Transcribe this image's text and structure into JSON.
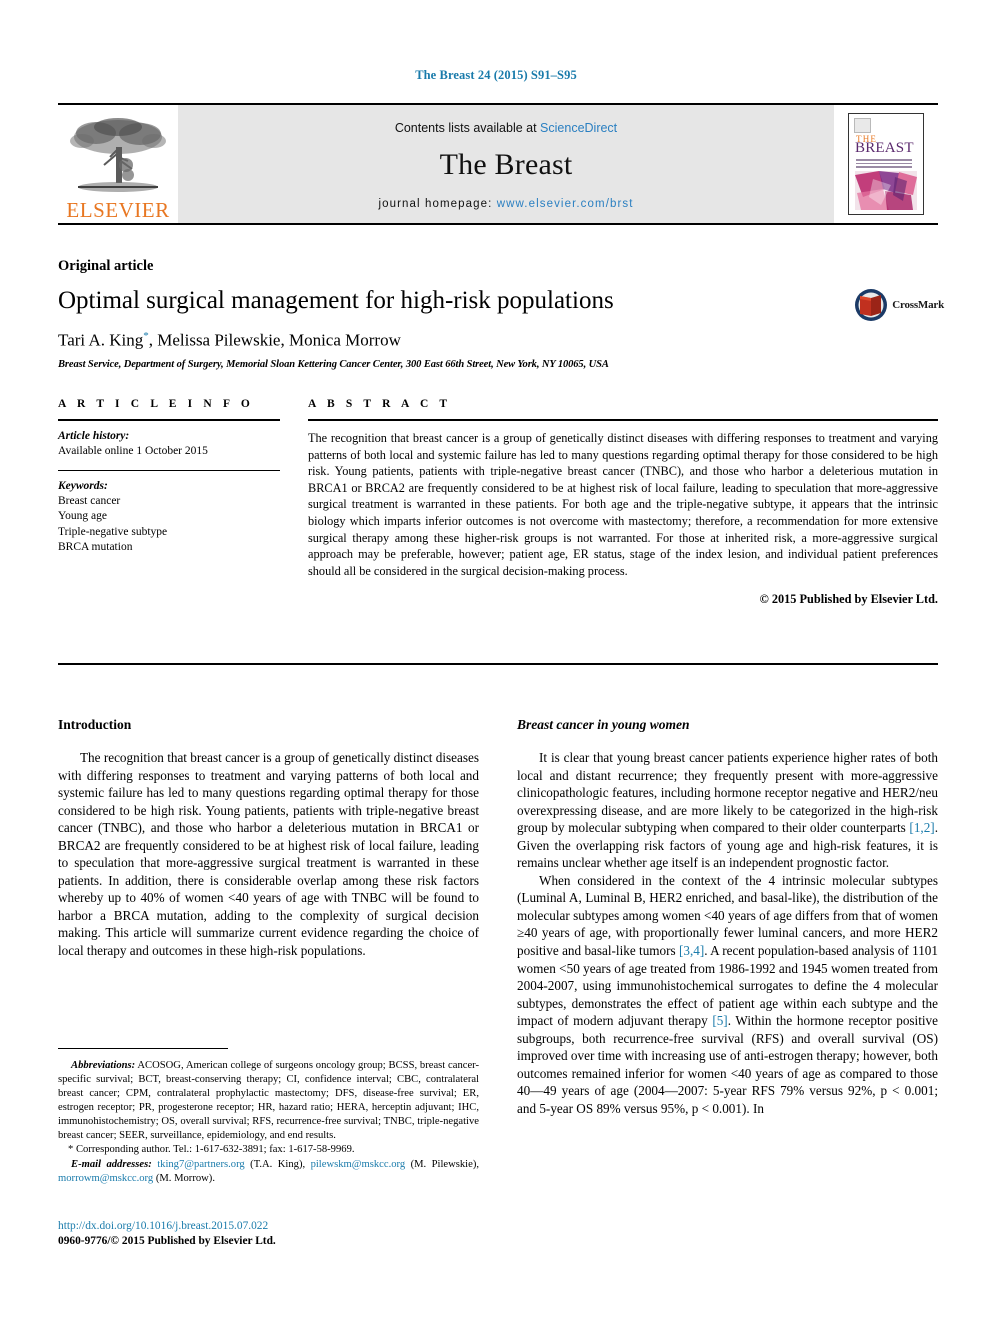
{
  "running_head": "The Breast 24 (2015) S91–S95",
  "masthead": {
    "publisher_name": "ELSEVIER",
    "contents_prefix": "Contents lists available at ",
    "contents_link": "ScienceDirect",
    "journal_name": "The Breast",
    "homepage_prefix": "journal homepage: ",
    "homepage_url": "www.elsevier.com/brst",
    "cover": {
      "the": "THE",
      "breast": "BREAST"
    },
    "link_color": "#2a7fc1",
    "panel_color": "#e6e6e6"
  },
  "title_block": {
    "article_type": "Original article",
    "title": "Optimal surgical management for high-risk populations",
    "authors": "Tari A. King",
    "author_marker": "*",
    "authors_rest": ", Melissa Pilewskie, Monica Morrow",
    "affiliation": "Breast Service, Department of Surgery, Memorial Sloan Kettering Cancer Center, 300 East 66th Street, New York, NY 10065, USA"
  },
  "crossmark": {
    "label": "CrossMark"
  },
  "article_info": {
    "section_label": "A R T I C L E   I N F O",
    "history_head": "Article history:",
    "history_line": "Available online 1 October 2015",
    "keywords_head": "Keywords:",
    "keywords": [
      "Breast cancer",
      "Young age",
      "Triple-negative subtype",
      "BRCA mutation"
    ]
  },
  "abstract": {
    "section_label": "A B S T R A C T",
    "text": "The recognition that breast cancer is a group of genetically distinct diseases with differing responses to treatment and varying patterns of both local and systemic failure has led to many questions regarding optimal therapy for those considered to be high risk. Young patients, patients with triple-negative breast cancer (TNBC), and those who harbor a deleterious mutation in BRCA1 or BRCA2 are frequently considered to be at highest risk of local failure, leading to speculation that more-aggressive surgical treatment is warranted in these patients. For both age and the triple-negative subtype, it appears that the intrinsic biology which imparts inferior outcomes is not overcome with mastectomy; therefore, a recommendation for more extensive surgical therapy among these higher-risk groups is not warranted. For those at inherited risk, a more-aggressive surgical approach may be preferable, however; patient age, ER status, stage of the index lesion, and individual patient preferences should all be considered in the surgical decision-making process.",
    "copyright": "© 2015 Published by Elsevier Ltd."
  },
  "body": {
    "left_column": {
      "heading": "Introduction",
      "paragraph_1": "The recognition that breast cancer is a group of genetically distinct diseases with differing responses to treatment and varying patterns of both local and systemic failure has led to many questions regarding optimal therapy for those considered to be high risk. Young patients, patients with triple-negative breast cancer (TNBC), and those who harbor a deleterious mutation in BRCA1 or BRCA2 are frequently considered to be at highest risk of local failure, leading to speculation that more-aggressive surgical treatment is warranted in these patients. In addition, there is considerable overlap among these risk factors whereby up to 40% of women <40 years of age with TNBC will be found to harbor a BRCA mutation, adding to the complexity of surgical decision making. This article will summarize current evidence regarding the choice of local therapy and outcomes in these high-risk populations."
    },
    "right_column": {
      "heading": "Breast cancer in young women",
      "paragraph_1_a": "It is clear that young breast cancer patients experience higher rates of both local and distant recurrence; they frequently present with more-aggressive clinicopathologic features, including hormone receptor negative and HER2/neu overexpressing disease, and are more likely to be categorized in the high-risk group by molecular subtyping when compared to their older counterparts ",
      "paragraph_1_ref": "[1,2]",
      "paragraph_1_b": ". Given the overlapping risk factors of young age and high-risk features, it is remains unclear whether age itself is an independent prognostic factor.",
      "paragraph_2_a": "When considered in the context of the 4 intrinsic molecular subtypes (Luminal A, Luminal B, HER2 enriched, and basal-like), the distribution of the molecular subtypes among women <40 years of age differs from that of women ≥40 years of age, with proportionally fewer luminal cancers, and more HER2 positive and basal-like tumors ",
      "paragraph_2_ref1": "[3,4]",
      "paragraph_2_b": ". A recent population-based analysis of 1101 women <50 years of age treated from 1986-1992 and 1945 women treated from 2004-2007, using immunohistochemical surrogates to define the 4 molecular subtypes, demonstrates the effect of patient age within each subtype and the impact of modern adjuvant therapy ",
      "paragraph_2_ref2": "[5]",
      "paragraph_2_c": ". Within the hormone receptor positive subgroups, both recurrence-free survival (RFS) and overall survival (OS) improved over time with increasing use of anti-estrogen therapy; however, both outcomes remained inferior for women <40 years of age as compared to those 40—49 years of age (2004—2007: 5-year RFS 79% versus 92%, p < 0.001; and 5-year OS 89% versus 95%, p < 0.001). In"
    }
  },
  "footnotes": {
    "abbreviations_label": "Abbreviations:",
    "abbreviations_text": " ACOSOG, American college of surgeons oncology group; BCSS, breast cancer-specific survival; BCT, breast-conserving therapy; CI, confidence interval; CBC, contralateral breast cancer; CPM, contralateral prophylactic mastectomy; DFS, disease-free survival; ER, estrogen receptor; PR, progesterone receptor; HR, hazard ratio; HERA, herceptin adjuvant; IHC, immunohistochemistry; OS, overall survival; RFS, recurrence-free survival; TNBC, triple-negative breast cancer; SEER, surveillance, epidemiology, and end results.",
    "corresponding_marker": "*",
    "corresponding_text": " Corresponding author. Tel.: 1-617-632-3891; fax: 1-617-58-9969.",
    "email_label": "E-mail addresses:",
    "email_1": "tking7@partners.org",
    "email_1_name": " (T.A. King), ",
    "email_2": "pilewskm@mskcc.org",
    "email_2_name": " (M. Pilewskie), ",
    "email_3": "morrowm@mskcc.org",
    "email_3_name": " (M. Morrow)."
  },
  "footer": {
    "doi": "http://dx.doi.org/10.1016/j.breast.2015.07.022",
    "issn_line": "0960-9776/© 2015 Published by Elsevier Ltd."
  }
}
